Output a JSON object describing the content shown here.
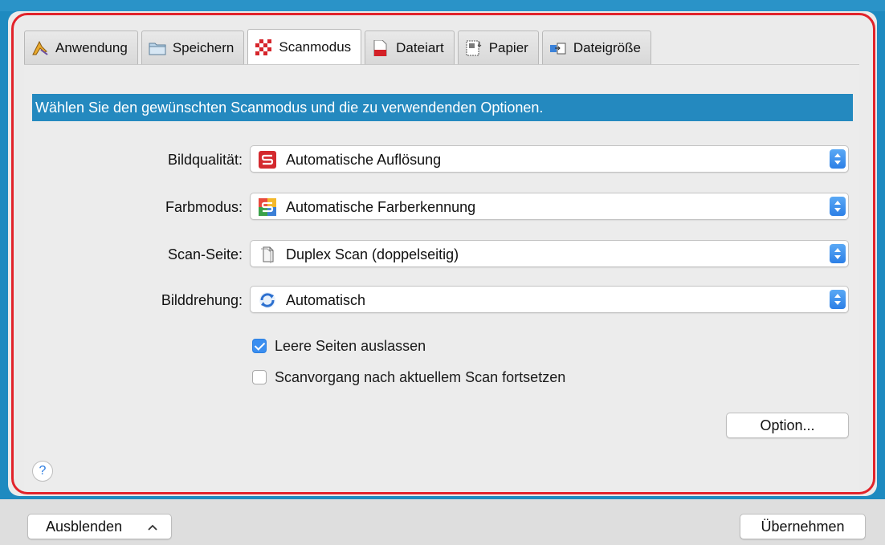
{
  "tabs": [
    {
      "label": "Anwendung",
      "icon": "application-icon"
    },
    {
      "label": "Speichern",
      "icon": "folder-icon"
    },
    {
      "label": "Scanmodus",
      "icon": "scan-mode-icon",
      "active": true
    },
    {
      "label": "Dateiart",
      "icon": "file-type-icon"
    },
    {
      "label": "Papier",
      "icon": "paper-icon"
    },
    {
      "label": "Dateigröße",
      "icon": "file-size-icon"
    }
  ],
  "banner": "Wählen Sie den gewünschten Scanmodus und die zu verwendenden Optionen.",
  "settings": [
    {
      "label": "Bildqualität:",
      "value": "Automatische Auflösung",
      "icon": "auto-resolution-icon"
    },
    {
      "label": "Farbmodus:",
      "value": "Automatische Farberkennung",
      "icon": "auto-color-icon"
    },
    {
      "label": "Scan-Seite:",
      "value": "Duplex Scan (doppelseitig)",
      "icon": "duplex-page-icon"
    },
    {
      "label": "Bilddrehung:",
      "value": "Automatisch",
      "icon": "auto-rotate-icon"
    }
  ],
  "checkboxes": [
    {
      "label": "Leere Seiten auslassen",
      "checked": true
    },
    {
      "label": "Scanvorgang nach aktuellem Scan fortsetzen",
      "checked": false
    }
  ],
  "buttons": {
    "option": "Option...",
    "help": "?",
    "hide": "Ausblenden",
    "apply": "Übernehmen"
  },
  "colors": {
    "accent": "#2489bf",
    "highlight": "#e2232a",
    "select_arrow": "#2c7fe6"
  }
}
